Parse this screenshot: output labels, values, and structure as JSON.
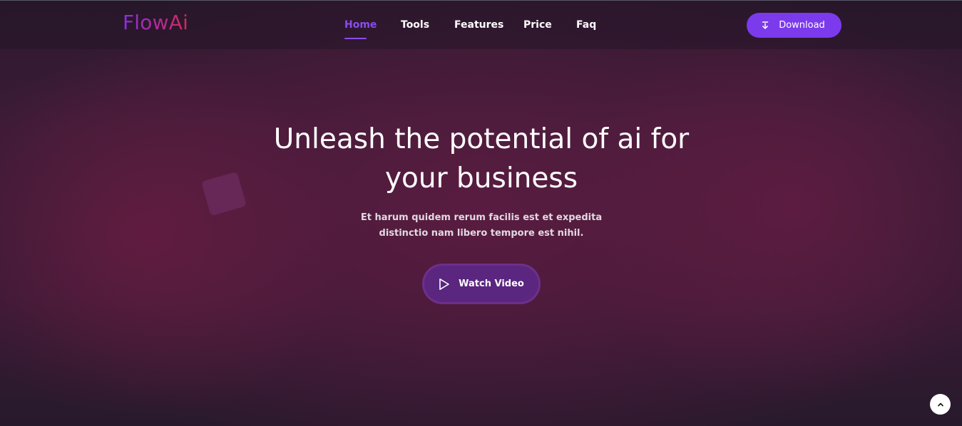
{
  "brand": {
    "logo_text": "FlowAi"
  },
  "nav": {
    "items": [
      {
        "label": "Home",
        "active": true
      },
      {
        "label": "Tools",
        "active": false
      },
      {
        "label": "Features",
        "active": false
      },
      {
        "label": "Price",
        "active": false
      },
      {
        "label": "Faq",
        "active": false
      }
    ]
  },
  "header_cta": {
    "label": "Download",
    "icon": "download-icon"
  },
  "hero": {
    "title": "Unleash the potential of ai for your business",
    "subtitle": "Et harum quidem rerum facilis est et expedita distinctio nam libero tempore est nihil.",
    "watch_label": "Watch Video",
    "watch_icon": "play-icon"
  },
  "scroll_top": {
    "icon": "chevron-up-icon"
  },
  "colors": {
    "accent": "#7c3aed",
    "nav_active": "#8b4cf0",
    "logo_gradient_start": "#8b2fe0",
    "logo_gradient_end": "#d12a5a",
    "background": "#3a1a35"
  }
}
